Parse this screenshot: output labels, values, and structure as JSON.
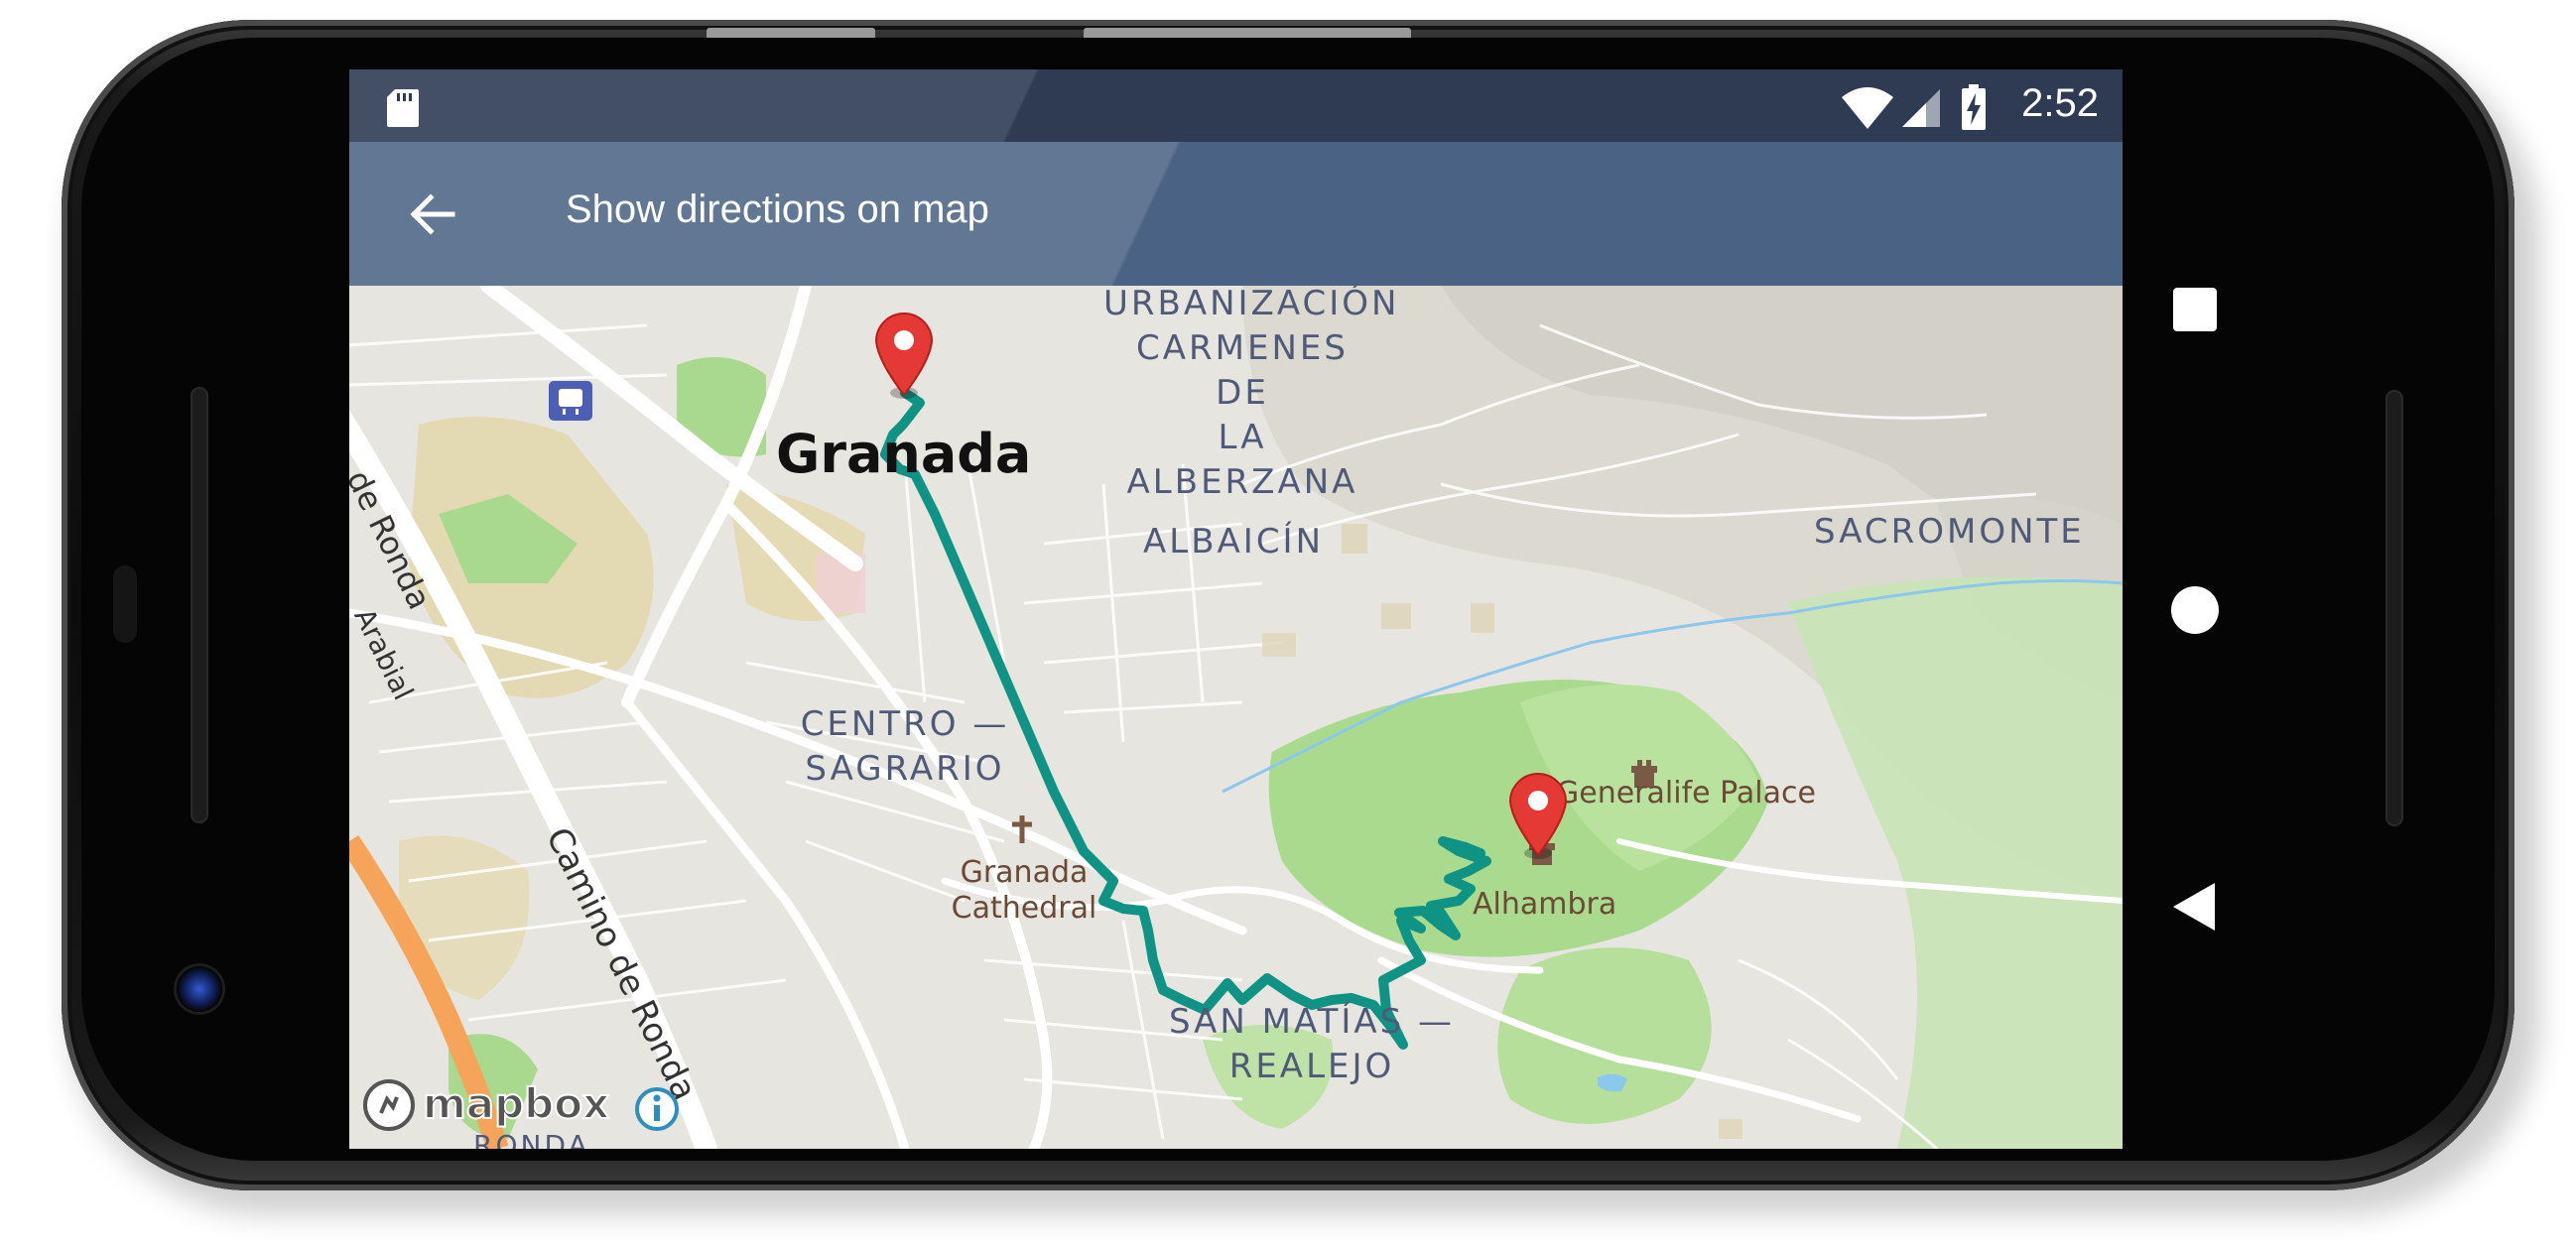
{
  "status_bar": {
    "time": "2:52",
    "icons": [
      "sd-card-icon",
      "wifi-icon",
      "cell-signal-icon",
      "battery-charging-icon"
    ]
  },
  "app_bar": {
    "back_icon": "arrow-back-icon",
    "title": "Show directions on map"
  },
  "map": {
    "labels": {
      "urbanizacion_1": "URBANIZACIÓN",
      "urbanizacion_2": "CARMENES DE",
      "urbanizacion_3": "LA ALBERZANA",
      "granada": "Granada",
      "albaicin": "ALBAICÍN",
      "sacromonte": "SACROMONTE",
      "de_ronda": "de Ronda",
      "arabial": "Arabial",
      "centro_1": "CENTRO —",
      "centro_2": "SAGRARIO",
      "cathedral_1": "Granada",
      "cathedral_2": "Cathedral",
      "generalife": "Generalife Palace",
      "alhambra": "Alhambra",
      "camino": "Camino de Ronda",
      "san_matias_1": "SAN MATÍAS —",
      "san_matias_2": "REALEJO",
      "ronda": "RONDA"
    },
    "attribution": "mapbox",
    "route_color": "#0f9384",
    "marker_color": "#e53935"
  },
  "nav_bar": {
    "icons": [
      "recents-square-icon",
      "home-circle-icon",
      "back-triangle-icon"
    ]
  }
}
